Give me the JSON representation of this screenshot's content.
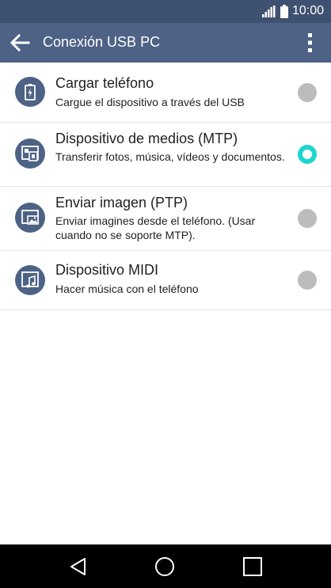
{
  "status_bar": {
    "time": "10:00",
    "icons": [
      "signal-icon",
      "battery-icon"
    ]
  },
  "app_bar": {
    "title": "Conexión USB PC",
    "back_icon": "back-arrow-icon",
    "menu_icon": "more-vert-icon"
  },
  "options": [
    {
      "title": "Cargar teléfono",
      "subtitle": "Cargue el dispositivo a través del USB",
      "icon": "battery-charge-icon",
      "selected": false
    },
    {
      "title": "Dispositivo de medios (MTP)",
      "subtitle": "Transferir fotos, música, vídeos y documentos.",
      "icon": "media-device-icon",
      "selected": true
    },
    {
      "title": "Enviar imagen (PTP)",
      "subtitle": "Enviar imagines desde el teléfono. (Usar cuando no se soporte MTP).",
      "icon": "image-transfer-icon",
      "selected": false
    },
    {
      "title": "Dispositivo MIDI",
      "subtitle": "Hacer música con el teléfono",
      "icon": "music-note-icon",
      "selected": false
    }
  ],
  "nav_bar": {
    "icons": [
      "back-triangle-icon",
      "home-circle-icon",
      "recents-square-icon"
    ]
  },
  "colors": {
    "status_bar": "#3f5170",
    "app_bar": "#4d6285",
    "radio_selected": "#1fd5cf",
    "radio_unselected": "#bcbcbc"
  }
}
